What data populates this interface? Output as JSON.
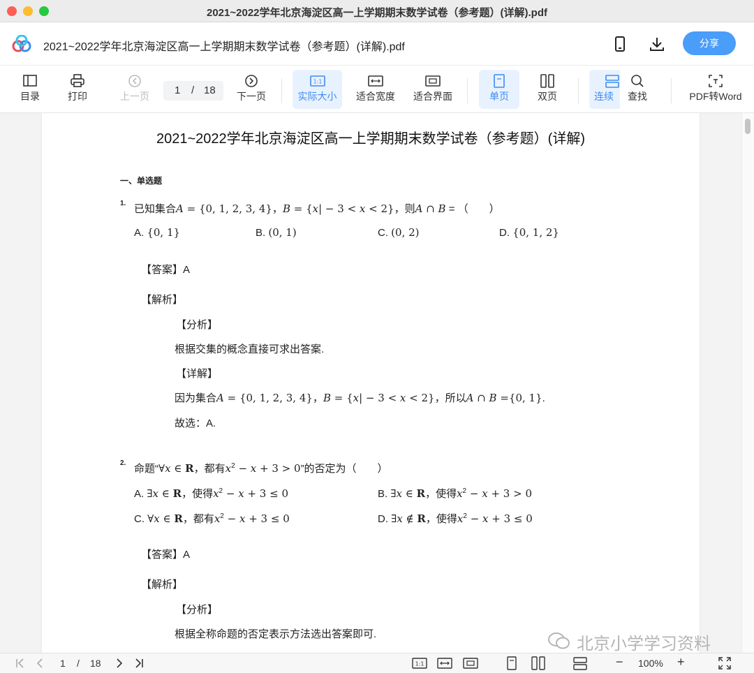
{
  "window": {
    "title": "2021~2022学年北京海淀区高一上学期期末数学试卷（参考题）(详解).pdf"
  },
  "appbar": {
    "doc_title": "2021~2022学年北京海淀区高一上学期期末数学试卷（参考题）(详解).pdf",
    "share_label": "分享",
    "icons": [
      "app-logo-icon",
      "phone-icon",
      "download-icon"
    ]
  },
  "toolbar": {
    "contents": "目录",
    "print": "打印",
    "prev": "上一页",
    "current_page": "1",
    "page_sep": "/",
    "total_pages": "18",
    "next": "下一页",
    "actual_size": "实际大小",
    "fit_width": "适合宽度",
    "fit_page": "适合界面",
    "single": "单页",
    "double": "双页",
    "continuous": "连续",
    "find": "查找",
    "pdf_to_word": "PDF转Word",
    "accent_color": "#3c8cf0"
  },
  "document": {
    "title": "2021~2022学年北京海淀区高一上学期期末数学试卷（参考题）(详解)",
    "section": "一、单选题",
    "q1": {
      "num": "1.",
      "stem_a": "已知集合",
      "stem_b": "A",
      "stem_c": " = {0, 1, 2, 3, 4}",
      "stem_d": "，",
      "stem_e": "B",
      "stem_f": " = {",
      "stem_g": "x",
      "stem_h": "| − 3 < ",
      "stem_i": "x",
      "stem_j": " < 2}",
      "stem_k": "，则",
      "stem_l": "A",
      "stem_m": " ∩ ",
      "stem_n": "B",
      "stem_o": " = （　　）",
      "opt_a_label": "A. ",
      "opt_a": "{0, 1}",
      "opt_b_label": "B. ",
      "opt_b": "(0, 1)",
      "opt_c_label": "C. ",
      "opt_c": "(0, 2)",
      "opt_d_label": "D. ",
      "opt_d": "{0, 1, 2}",
      "answer": "【答案】A",
      "analysis": "【解析】",
      "fenxi": "【分析】",
      "fenxi_text": "根据交集的概念直接可求出答案.",
      "xiangjie": "【详解】",
      "detail_a": "因为集合",
      "detail_b": "A",
      "detail_c": " = {0, 1, 2, 3, 4}",
      "detail_d": "，",
      "detail_e": "B",
      "detail_f": " = {",
      "detail_g": "x",
      "detail_h": "| − 3 < ",
      "detail_i": "x",
      "detail_j": " < 2}",
      "detail_k": "，所以",
      "detail_l": "A",
      "detail_m": " ∩ ",
      "detail_n": "B",
      "detail_o": " =",
      "detail_p": "{0, 1}",
      "detail_q": ".",
      "conclusion": "故选：A."
    },
    "q2": {
      "num": "2.",
      "stem_a": "命题“",
      "stem_b": "∀",
      "stem_c": "x",
      "stem_d": " ∈ ",
      "stem_e": "R",
      "stem_f": "，都有",
      "stem_g": "x",
      "stem_h": "2",
      "stem_i": " − ",
      "stem_j": "x",
      "stem_k": " + 3 > 0",
      "stem_l": "”的否定为（　　）",
      "oa_1": "A. ",
      "oa_2": "∃",
      "oa_3": "x",
      "oa_4": " ∈ ",
      "oa_5": "R",
      "oa_6": "，使得",
      "oa_7": "x",
      "oa_8": "2",
      "oa_9": " − ",
      "oa_10": "x",
      "oa_11": " + 3 ≤ 0",
      "ob_1": "B. ",
      "ob_2": "∃",
      "ob_3": "x",
      "ob_4": " ∈ ",
      "ob_5": "R",
      "ob_6": "，使得",
      "ob_7": "x",
      "ob_8": "2",
      "ob_9": " − ",
      "ob_10": "x",
      "ob_11": " + 3 > 0",
      "oc_1": "C. ",
      "oc_2": "∀",
      "oc_3": "x",
      "oc_4": " ∈ ",
      "oc_5": "R",
      "oc_6": "，都有",
      "oc_7": "x",
      "oc_8": "2",
      "oc_9": " − ",
      "oc_10": "x",
      "oc_11": " + 3 ≤ 0",
      "od_1": "D. ",
      "od_2": "∃",
      "od_3": "x",
      "od_4": " ∉ ",
      "od_5": "R",
      "od_6": "，使得",
      "od_7": "x",
      "od_8": "2",
      "od_9": " − ",
      "od_10": "x",
      "od_11": " + 3 ≤ 0",
      "answer": "【答案】A",
      "analysis": "【解析】",
      "fenxi": "【分析】",
      "fenxi_text": "根据全称命题的否定表示方法选出答案即可."
    },
    "watermark": "北京小学学习资料"
  },
  "bottombar": {
    "current_page": "1",
    "page_sep": "/",
    "total_pages": "18",
    "zoom": "100%",
    "minus": "−",
    "plus": "+"
  }
}
